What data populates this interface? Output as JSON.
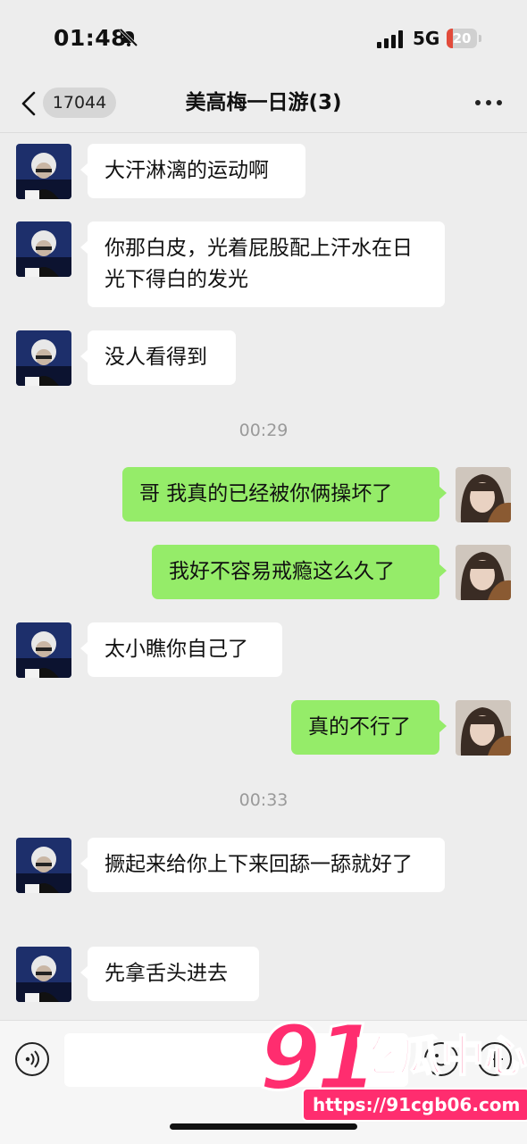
{
  "status_bar": {
    "time": "01:48",
    "network": "5G",
    "battery": "20",
    "battery_level": 0.2
  },
  "nav": {
    "back_count": "17044",
    "title": "美高梅一日游(3)"
  },
  "messages": [
    {
      "side": "left",
      "text": "大汗淋漓的运动啊"
    },
    {
      "side": "left",
      "text": "你那白皮，光着屁股配上汗水在日光下得白的发光"
    },
    {
      "side": "left",
      "text": "没人看得到"
    },
    {
      "type": "time",
      "text": "00:29"
    },
    {
      "side": "right",
      "text": "哥 我真的已经被你俩操坏了"
    },
    {
      "side": "right",
      "text": "我好不容易戒瘾这么久了"
    },
    {
      "side": "left",
      "text": "太小瞧你自己了"
    },
    {
      "side": "right",
      "text": "真的不行了"
    },
    {
      "type": "time",
      "text": "00:33"
    },
    {
      "side": "left",
      "text": "撅起来给你上下来回舔一舔就好了"
    },
    {
      "side": "left",
      "text": "先拿舌头进去"
    }
  ],
  "watermark": {
    "number": "91",
    "name": "吃瓜中心",
    "url": "https://91cgb06.com"
  },
  "colors": {
    "bubble_sent": "#95ec69",
    "bubble_received": "#ffffff",
    "background": "#ededed",
    "watermark": "#ff2d6f"
  },
  "icons": [
    "bell-slash-icon",
    "signal-icon",
    "battery-icon",
    "back-chevron-icon",
    "more-icon",
    "voice-icon",
    "emoji-icon",
    "plus-icon"
  ]
}
